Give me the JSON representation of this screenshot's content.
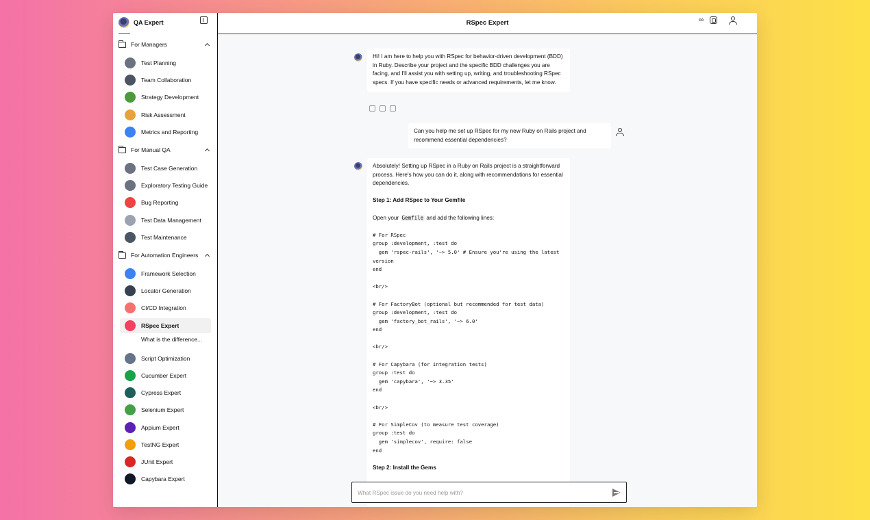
{
  "sidebar": {
    "brand": "QA Expert",
    "sections": [
      {
        "label": "For Managers",
        "items": [
          {
            "label": "Test Planning",
            "color": "#6b7280"
          },
          {
            "label": "Team Collaboration",
            "color": "#4b5563"
          },
          {
            "label": "Strategy Development",
            "color": "#4d9a3e"
          },
          {
            "label": "Risk Assessment",
            "color": "#e9a23b"
          },
          {
            "label": "Metrics and Reporting",
            "color": "#3b82f6"
          }
        ]
      },
      {
        "label": "For Manual QA",
        "items": [
          {
            "label": "Test Case Generation",
            "color": "#6b7280"
          },
          {
            "label": "Exploratory Testing Guide",
            "color": "#6b7280"
          },
          {
            "label": "Bug Reporting",
            "color": "#ef4444"
          },
          {
            "label": "Test Data Management",
            "color": "#9ca3af"
          },
          {
            "label": "Test Maintenance",
            "color": "#4b5563"
          }
        ]
      },
      {
        "label": "For Automation Engineers",
        "items": [
          {
            "label": "Framework Selection",
            "color": "#3b82f6"
          },
          {
            "label": "Locator Generation",
            "color": "#374151"
          },
          {
            "label": "CI/CD Integration",
            "color": "#f87171"
          },
          {
            "label": "RSpec Expert",
            "color": "#f43f5e"
          },
          {
            "label": "Script Optimization",
            "color": "#64748b"
          },
          {
            "label": "Cucumber Expert",
            "color": "#16a34a"
          },
          {
            "label": "Cypress Expert",
            "color": "#1f5f5b"
          },
          {
            "label": "Selenium Expert",
            "color": "#43a047"
          },
          {
            "label": "Appium Expert",
            "color": "#5b21b6"
          },
          {
            "label": "TestNG Expert",
            "color": "#f59e0b"
          },
          {
            "label": "JUnit Expert",
            "color": "#dc2626"
          },
          {
            "label": "Capybara Expert",
            "color": "#111827"
          }
        ]
      }
    ],
    "active_sub": "What is the difference..."
  },
  "header": {
    "title": "RSpec Expert",
    "infinity": "∞"
  },
  "chat": {
    "bot_intro": "Hi! I am here to help you with RSpec for behavior-driven development (BDD) in Ruby. Describe your project and the specific BDD challenges you are facing, and I'll assist you with setting up, writing, and troubleshooting RSpec specs. If you have specific needs or advanced requirements, let me know.",
    "user_msg": "Can you help me set up RSpec for my new Ruby on Rails project and recommend essential dependencies?",
    "answer_intro": "Absolutely! Setting up RSpec in a Ruby on Rails project is a straightforward process. Here's how you can do it, along with recommendations for essential dependencies.",
    "step1": "Step 1: Add RSpec to Your Gemfile",
    "open_prefix": "Open your",
    "gemfile": "Gemfile",
    "open_suffix": "and add the following lines:",
    "code1": "# For RSpec\ngroup :development, :test do\n  gem 'rspec-rails', '~> 5.0' # Ensure you're using the latest version\nend",
    "br1": "<br/>",
    "code2": "# For FactoryBot (optional but recommended for test data)\ngroup :development, :test do\n  gem 'factory_bot_rails', '~> 6.0'\nend",
    "br2": "<br/>",
    "code3": "# For Capybara (for integration tests)\ngroup :test do\n  gem 'capybara', '~> 3.35'\nend",
    "br3": "<br/>",
    "code4": "# For SimpleCov (to measure test coverage)\ngroup :test do\n  gem 'simplecov', require: false\nend",
    "step2": "Step 2: Install the Gems"
  },
  "input": {
    "placeholder": "What RSpec issue do you need help with?"
  }
}
